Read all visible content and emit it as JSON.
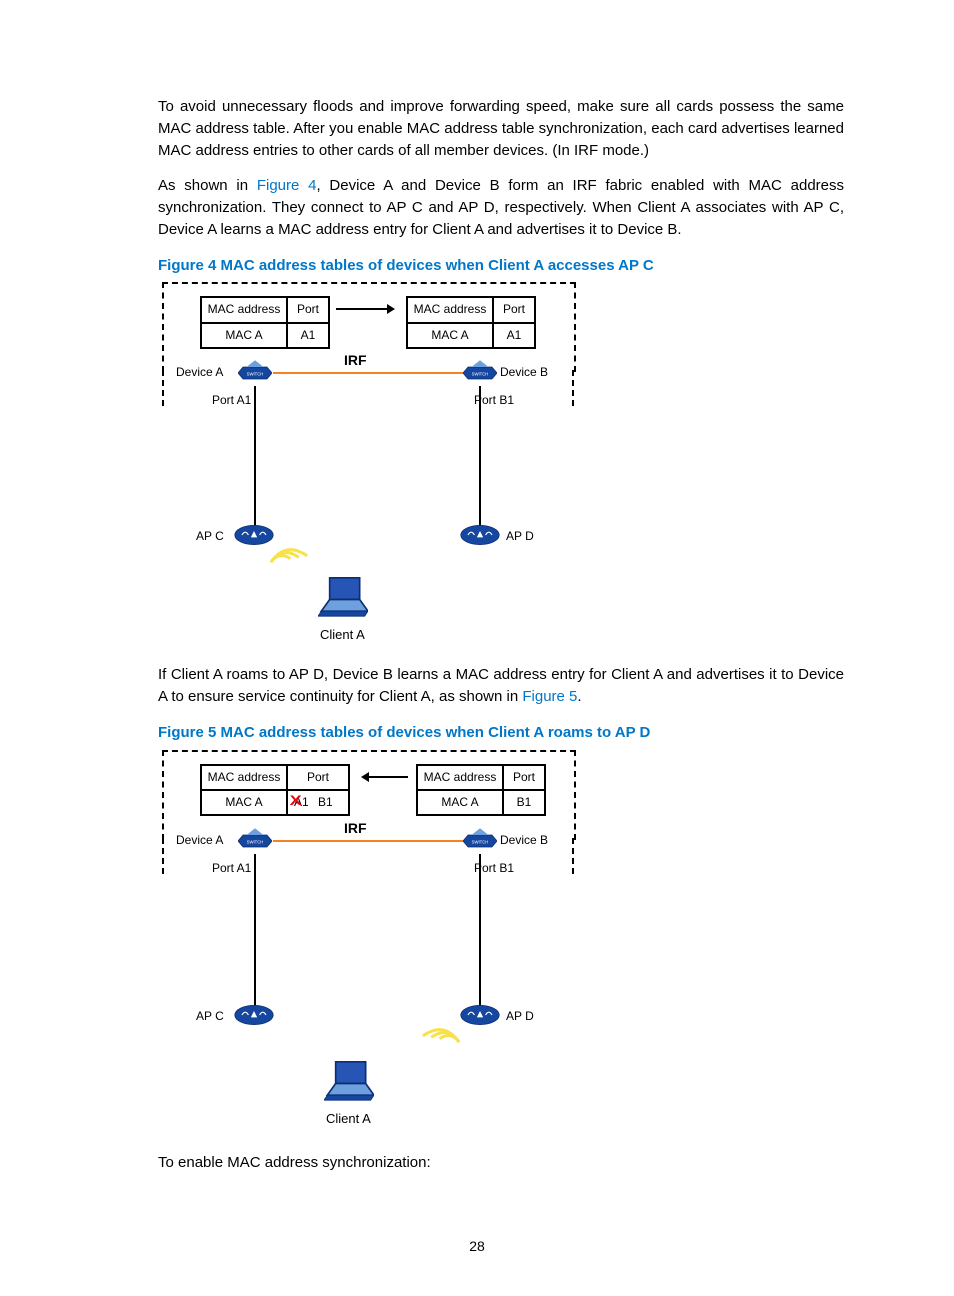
{
  "paragraphs": {
    "p1": "To avoid unnecessary floods and improve forwarding speed, make sure all cards possess the same MAC address table. After you enable MAC address table synchronization, each card advertises learned MAC address entries to other cards of all member devices. (In IRF mode.)",
    "p2a": "As shown in ",
    "p2link": "Figure 4",
    "p2b": ", Device A and Device B form an IRF fabric enabled with MAC address synchronization. They connect to AP C and AP D, respectively. When Client A associates with AP C, Device A learns a MAC address entry for Client A and advertises it to Device B.",
    "p3a": "If Client A roams to AP D, Device B learns a MAC address entry for Client A and advertises it to Device A to ensure service continuity for Client A, as shown in ",
    "p3link": "Figure 5",
    "p3b": ".",
    "p4": "To enable MAC address synchronization:"
  },
  "figures": {
    "f4": {
      "caption": "Figure 4 MAC address tables of devices when Client A accesses AP C",
      "tableA": {
        "h1": "MAC address",
        "h2": "Port",
        "r1": "MAC A",
        "r2": "A1"
      },
      "tableB": {
        "h1": "MAC address",
        "h2": "Port",
        "r1": "MAC A",
        "r2": "A1"
      },
      "labels": {
        "deviceA": "Device A",
        "deviceB": "Device B",
        "portA1": "Port A1",
        "portB1": "Port B1",
        "irf": "IRF",
        "apC": "AP C",
        "apD": "AP D",
        "clientA": "Client A"
      }
    },
    "f5": {
      "caption": "Figure 5 MAC address tables of devices when Client A roams to AP D",
      "tableA": {
        "h1": "MAC address",
        "h2": "Port",
        "r1": "MAC A",
        "r2a": "A1",
        "r2b": "B1"
      },
      "tableB": {
        "h1": "MAC address",
        "h2": "Port",
        "r1": "MAC A",
        "r2": "B1"
      },
      "labels": {
        "deviceA": "Device A",
        "deviceB": "Device B",
        "portA1": "Port A1",
        "portB1": "Port B1",
        "irf": "IRF",
        "apC": "AP C",
        "apD": "AP D",
        "clientA": "Client A"
      }
    }
  },
  "pageNumber": "28"
}
